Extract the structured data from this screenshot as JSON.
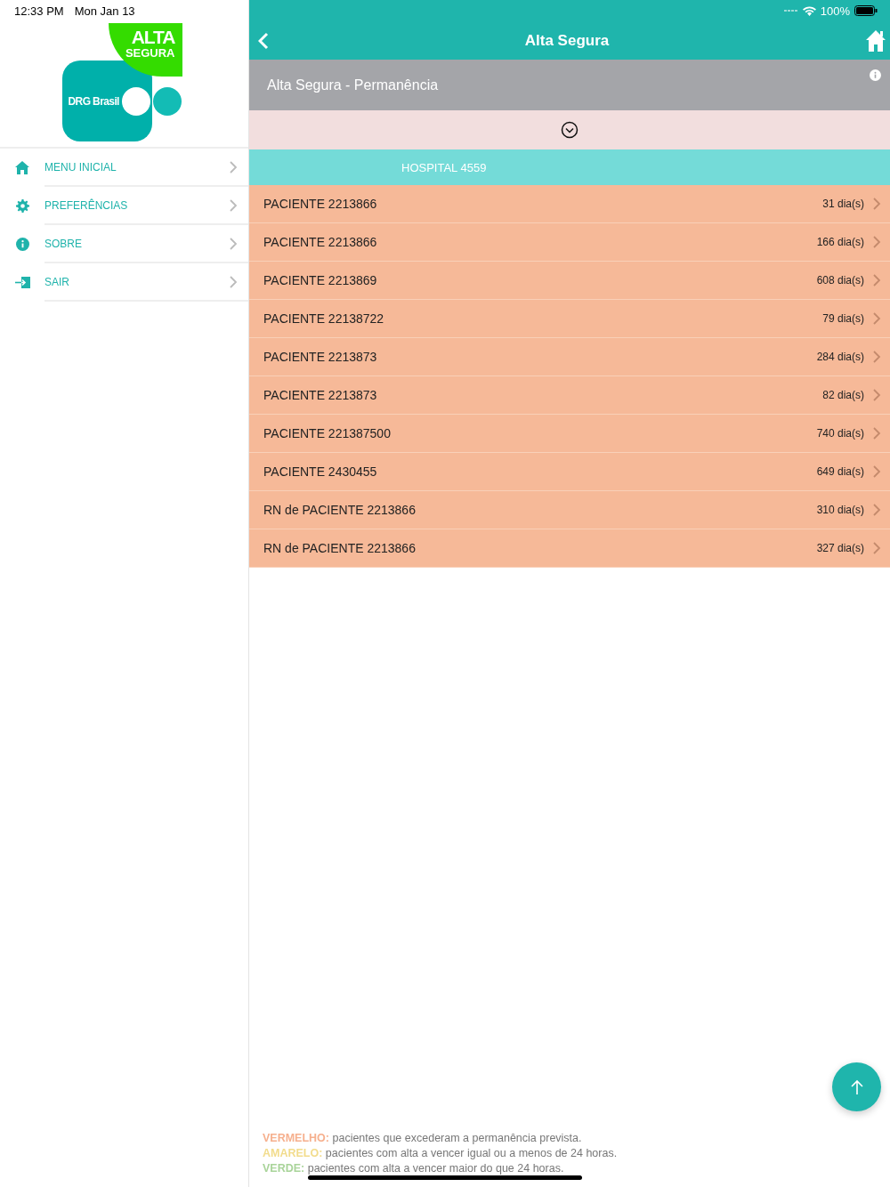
{
  "status_bar": {
    "time": "12:33 PM",
    "date": "Mon Jan 13",
    "battery": "100%"
  },
  "logo": {
    "title": "ALTA",
    "subtitle": "SEGURA",
    "brand": "DRG Brasil"
  },
  "sidebar": {
    "items": [
      {
        "kind": "home",
        "label": "MENU INICIAL"
      },
      {
        "kind": "gear",
        "label": "PREFERÊNCIAS"
      },
      {
        "kind": "info",
        "label": "SOBRE"
      },
      {
        "kind": "exit",
        "label": "SAIR"
      }
    ]
  },
  "nav_bar": {
    "title": "Alta Segura"
  },
  "section_header": {
    "title": "Alta Segura - Permanência"
  },
  "group": {
    "title": "HOSPITAL 4559"
  },
  "patients": [
    {
      "name": "PACIENTE 2213866",
      "days": "31 dia(s)",
      "color": "#f6b998"
    },
    {
      "name": "PACIENTE 2213866",
      "days": "166 dia(s)",
      "color": "#f6b998"
    },
    {
      "name": "PACIENTE 2213869",
      "days": "608 dia(s)",
      "color": "#f6b998"
    },
    {
      "name": "PACIENTE 22138722",
      "days": "79 dia(s)",
      "color": "#f6b998"
    },
    {
      "name": "PACIENTE 2213873",
      "days": "284 dia(s)",
      "color": "#f6b998"
    },
    {
      "name": "PACIENTE 2213873",
      "days": "82 dia(s)",
      "color": "#f6b998"
    },
    {
      "name": "PACIENTE 221387500",
      "days": "740 dia(s)",
      "color": "#f6b998"
    },
    {
      "name": "PACIENTE 2430455",
      "days": "649 dia(s)",
      "color": "#f6b998"
    },
    {
      "name": "RN de PACIENTE 2213866",
      "days": "310 dia(s)",
      "color": "#f6b998"
    },
    {
      "name": "RN de PACIENTE 2213866",
      "days": "327 dia(s)",
      "color": "#f6b998"
    }
  ],
  "legend": [
    {
      "label": "VERMELHO:",
      "text": "pacientes que excederam a permanência prevista.",
      "color": "#f6b08e"
    },
    {
      "label": "AMARELO:",
      "text": "pacientes com alta a vencer igual ou a menos de 24 horas.",
      "color": "#f2dc8c"
    },
    {
      "label": "VERDE:",
      "text": "pacientes com alta a vencer maior do que 24 horas.",
      "color": "#a9d49a"
    }
  ]
}
